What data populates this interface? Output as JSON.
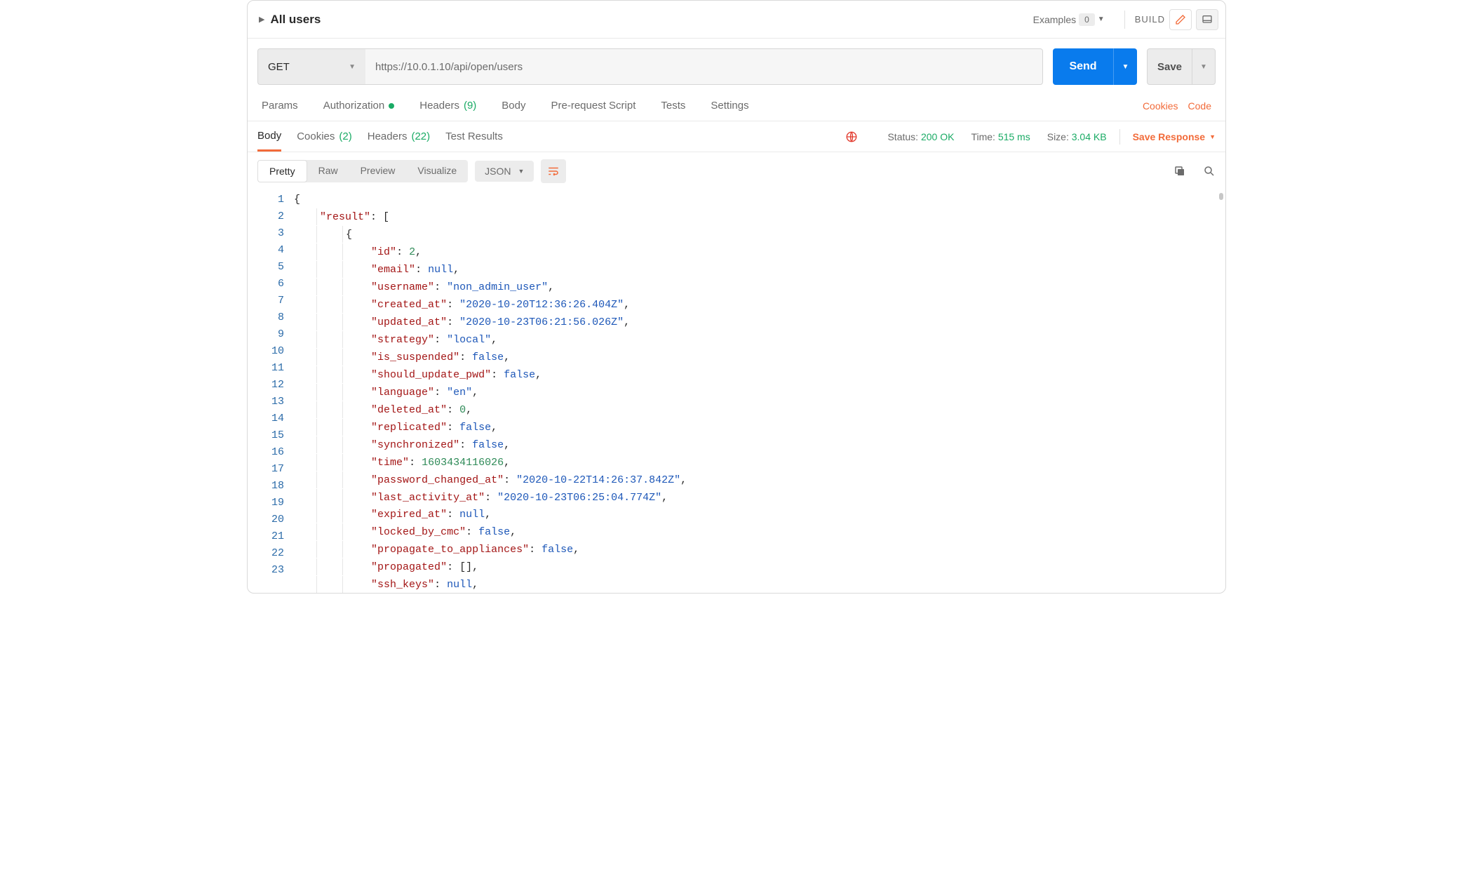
{
  "header": {
    "title": "All users",
    "examples_label": "Examples",
    "examples_count": "0",
    "build_label": "BUILD"
  },
  "request": {
    "method": "GET",
    "url": "https://10.0.1.10/api/open/users",
    "send_label": "Send",
    "save_label": "Save"
  },
  "req_tabs": {
    "params": "Params",
    "authorization": "Authorization",
    "headers": "Headers",
    "headers_count": "(9)",
    "body": "Body",
    "prerequest": "Pre-request Script",
    "tests": "Tests",
    "settings": "Settings",
    "cookies_link": "Cookies",
    "code_link": "Code"
  },
  "resp_tabs": {
    "body": "Body",
    "cookies": "Cookies",
    "cookies_count": "(2)",
    "headers": "Headers",
    "headers_count": "(22)",
    "test_results": "Test Results",
    "status_label": "Status:",
    "status_val": "200 OK",
    "time_label": "Time:",
    "time_val": "515 ms",
    "size_label": "Size:",
    "size_val": "3.04 KB",
    "save_response": "Save Response"
  },
  "view": {
    "pretty": "Pretty",
    "raw": "Raw",
    "preview": "Preview",
    "visualize": "Visualize",
    "format": "JSON"
  },
  "response_body": {
    "result": [
      {
        "id": 2,
        "email": null,
        "username": "non_admin_user",
        "created_at": "2020-10-20T12:36:26.404Z",
        "updated_at": "2020-10-23T06:21:56.026Z",
        "strategy": "local",
        "is_suspended": false,
        "should_update_pwd": false,
        "language": "en",
        "deleted_at": 0,
        "replicated": false,
        "synchronized": false,
        "time": 1603434116026,
        "password_changed_at": "2020-10-22T14:26:37.842Z",
        "last_activity_at": "2020-10-23T06:25:04.774Z",
        "expired_at": null,
        "locked_by_cmc": false,
        "propagate_to_appliances": false,
        "propagated": [],
        "ssh_keys": null
      }
    ]
  },
  "lines": [
    "1",
    "2",
    "3",
    "4",
    "5",
    "6",
    "7",
    "8",
    "9",
    "10",
    "11",
    "12",
    "13",
    "14",
    "15",
    "16",
    "17",
    "18",
    "19",
    "20",
    "21",
    "22",
    "23"
  ]
}
